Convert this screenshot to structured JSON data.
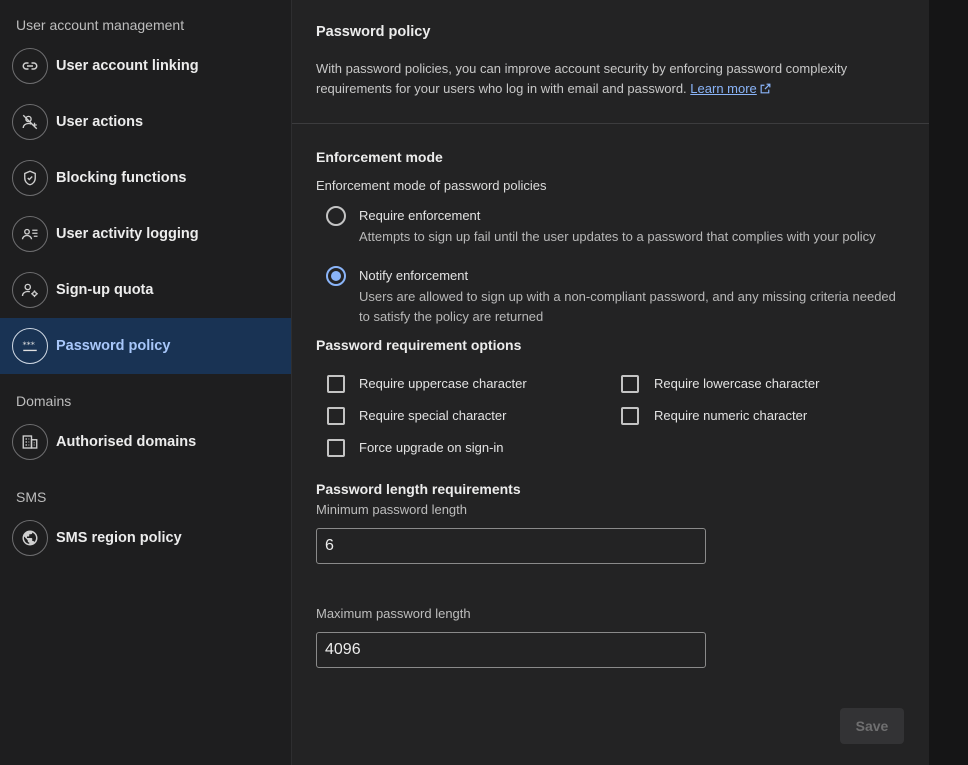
{
  "sidebar": {
    "section_user": "User account management",
    "section_domains": "Domains",
    "section_sms": "SMS",
    "items": [
      {
        "label": "User account linking"
      },
      {
        "label": "User actions"
      },
      {
        "label": "Blocking functions"
      },
      {
        "label": "User activity logging"
      },
      {
        "label": "Sign-up quota"
      },
      {
        "label": "Password policy"
      },
      {
        "label": "Authorised domains"
      },
      {
        "label": "SMS region policy"
      }
    ],
    "active_item": "Password policy",
    "active_color": "#a8c7fa"
  },
  "main": {
    "title": "Password policy",
    "description": "With password policies, you can improve account security by enforcing password complexity requirements for your users who log in with email and password.",
    "learn_more": "Learn more",
    "enforcement": {
      "heading": "Enforcement mode",
      "subheading": "Enforcement mode of password policies",
      "options": [
        {
          "label": "Require enforcement",
          "desc": "Attempts to sign up fail until the user updates to a password that complies with your policy",
          "checked": false
        },
        {
          "label": "Notify enforcement",
          "desc": "Users are allowed to sign up with a non-compliant password, and any missing criteria needed to satisfy the policy are returned",
          "checked": true
        }
      ]
    },
    "requirements": {
      "heading": "Password requirement options",
      "options": [
        {
          "label": "Require uppercase character",
          "checked": false
        },
        {
          "label": "Require lowercase character",
          "checked": false
        },
        {
          "label": "Require special character",
          "checked": false
        },
        {
          "label": "Require numeric character",
          "checked": false
        },
        {
          "label": "Force upgrade on sign-in",
          "checked": false
        }
      ]
    },
    "length": {
      "heading": "Password length requirements",
      "min_label": "Minimum password length",
      "min_value": "6",
      "max_label": "Maximum password length",
      "max_value": "4096"
    },
    "save_label": "Save"
  }
}
